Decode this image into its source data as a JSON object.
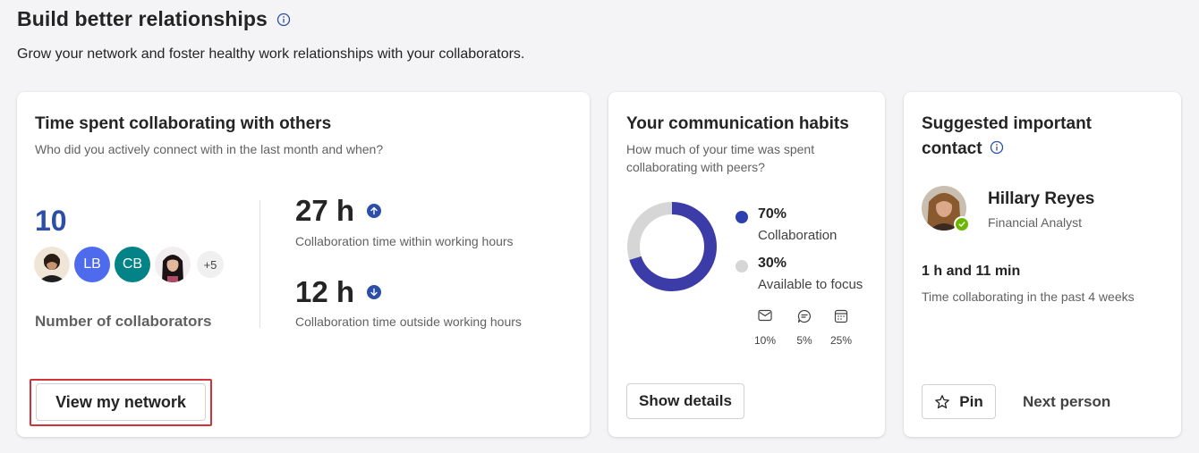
{
  "header": {
    "title": "Build better relationships",
    "subtitle": "Grow your network and foster healthy work relationships with your collaborators.",
    "info_icon": "info-icon"
  },
  "collaborating_card": {
    "title": "Time spent collaborating with others",
    "description": "Who did you actively connect with in the last month and when?",
    "collaborator_count": "10",
    "avatars": [
      {
        "type": "photo",
        "name": "person-photo-1"
      },
      {
        "type": "initials",
        "initials": "LB",
        "color": "#4f6bed"
      },
      {
        "type": "initials",
        "initials": "CB",
        "color": "#038387"
      },
      {
        "type": "photo",
        "name": "person-photo-2"
      }
    ],
    "more_count": "+5",
    "collaborators_label": "Number of collaborators",
    "within_hours_value": "27 h",
    "within_hours_trend": "up",
    "within_hours_label": "Collaboration time within working hours",
    "outside_hours_value": "12 h",
    "outside_hours_trend": "down",
    "outside_hours_label": "Collaboration time outside working hours",
    "button_label": "View my network"
  },
  "communication_card": {
    "title": "Your communication habits",
    "description": "How much of your time was spent collaborating with peers?",
    "legend": [
      {
        "pct": "70%",
        "name": "Collaboration",
        "color": "#3c3ca8"
      },
      {
        "pct": "30%",
        "name": "Available to focus",
        "color": "#d6d6d6"
      }
    ],
    "donut_fraction": 0.7,
    "habits": [
      {
        "icon": "mail-icon",
        "pct": "10%"
      },
      {
        "icon": "chat-icon",
        "pct": "5%"
      },
      {
        "icon": "calendar-icon",
        "pct": "25%"
      }
    ],
    "button_label": "Show details"
  },
  "contact_card": {
    "title": "Suggested important contact",
    "name": "Hillary Reyes",
    "role": "Financial Analyst",
    "presence": "available",
    "collab_time": "1 h and 11 min",
    "collab_time_label": "Time collaborating in the past 4 weeks",
    "pin_label": "Pin",
    "next_label": "Next person"
  },
  "colors": {
    "accent": "#2b4fa8",
    "highlight": "#d13438",
    "presence_green": "#6bb700"
  }
}
